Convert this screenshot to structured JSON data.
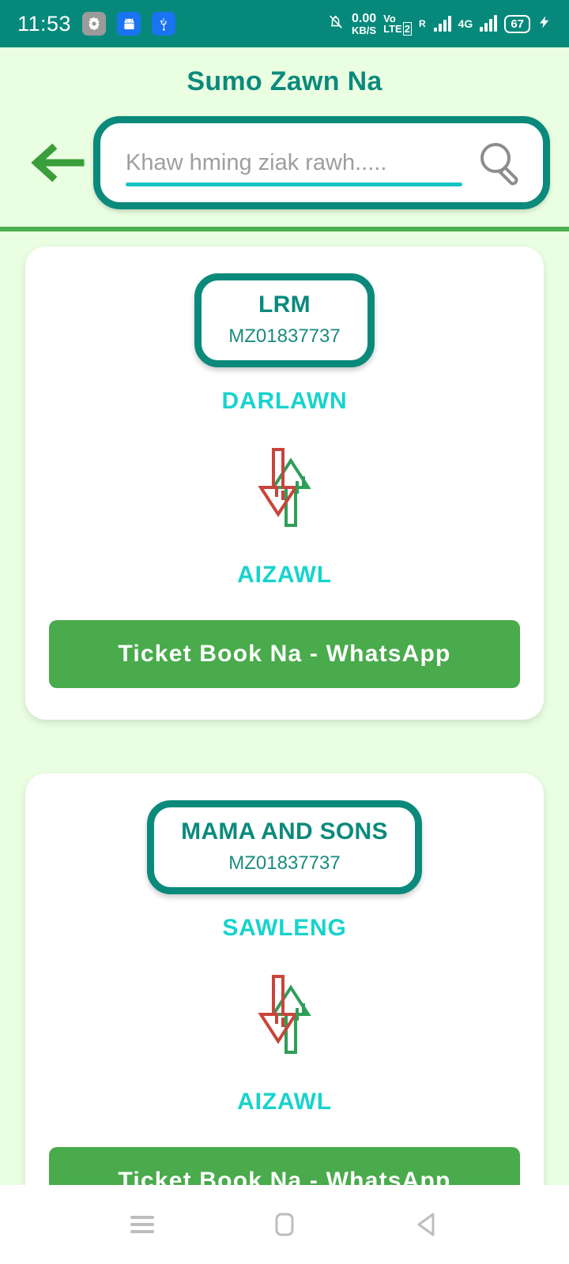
{
  "status_bar": {
    "time": "11:53",
    "icons": [
      "settings-gear-icon",
      "android-robot-icon",
      "usb-icon"
    ],
    "mute_icon": "bell-muted-icon",
    "data_rate_value": "0.00",
    "data_rate_unit": "KB/S",
    "volte_top": "Vo",
    "volte_bottom": "LTE",
    "sim_badge": "2",
    "roaming_letter": "R",
    "network_type": "4G",
    "battery_percent": "67",
    "charging_icon": "lightning-bolt-icon",
    "background_color": "#06897b"
  },
  "header": {
    "title": "Sumo Zawn Na",
    "title_color": "#0b8a7c",
    "back_icon": "back-arrow-icon",
    "search": {
      "placeholder": "Khaw hming ziak rawh.....",
      "value": "",
      "icon": "search-magnifier-icon",
      "border_color": "#0b8a7c",
      "underline_color": "#17c3c3"
    },
    "divider_color": "#4caf50"
  },
  "theme": {
    "page_background": "#eaffe2",
    "card_background": "#ffffff",
    "accent_teal": "#0b8a7c",
    "place_cyan": "#18d3cd",
    "whatsapp_green": "#49ab4b",
    "arrow_up_green": "#2e9e57",
    "arrow_down_red": "#c8453b"
  },
  "cards": [
    {
      "operator": "LRM",
      "vehicle_number": "MZ01837737",
      "from": "DARLAWN",
      "to": "AIZAWL",
      "route_icon": "up-down-arrow-icon",
      "book_button": "Ticket Book Na - WhatsApp"
    },
    {
      "operator": "MAMA AND SONS",
      "vehicle_number": "MZ01837737",
      "from": "SAWLENG",
      "to": "AIZAWL",
      "route_icon": "up-down-arrow-icon",
      "book_button": "Ticket Book Na - WhatsApp"
    }
  ],
  "navbar": {
    "menu_icon": "hamburger-menu-icon",
    "home_icon": "home-square-icon",
    "back_icon": "back-triangle-icon"
  }
}
